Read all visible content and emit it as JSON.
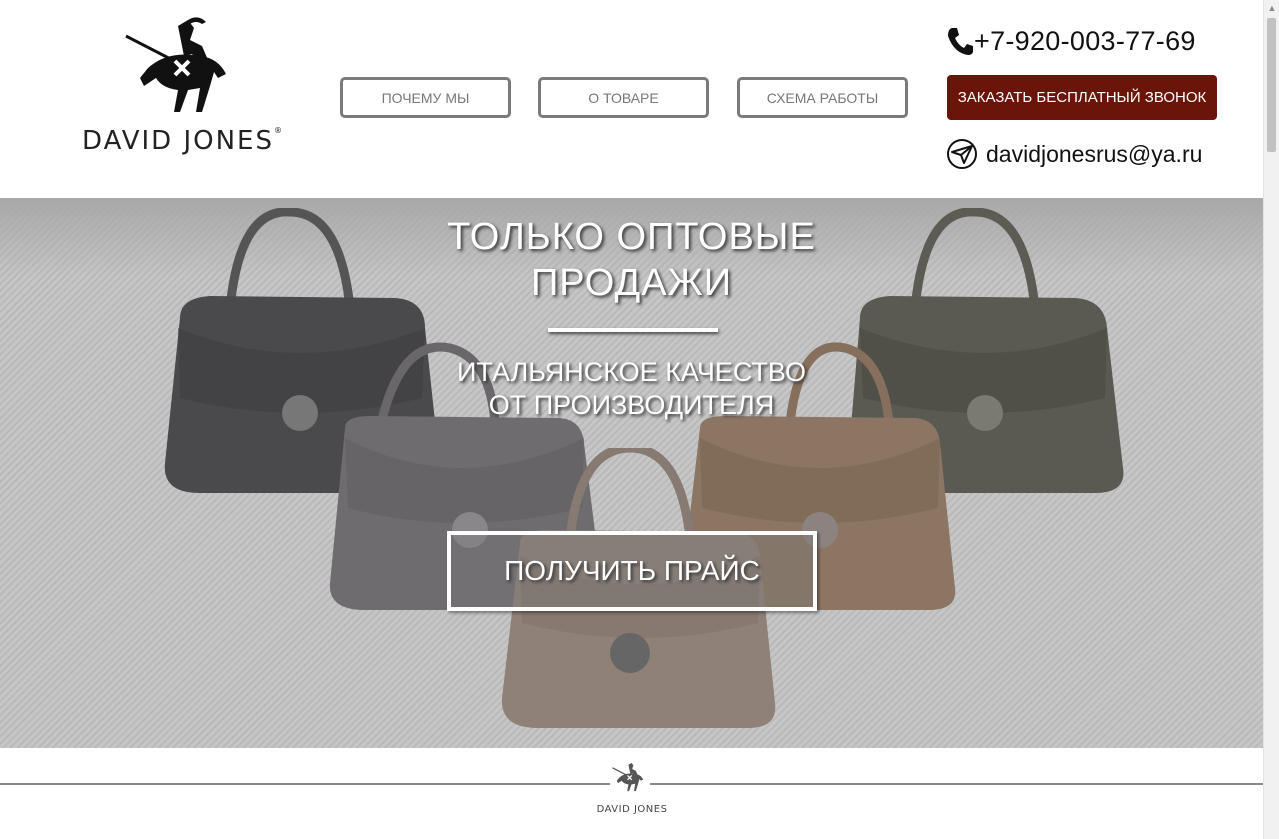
{
  "brand": {
    "name": "DAVID JONES",
    "registered_mark": "®"
  },
  "nav": {
    "items": [
      {
        "label": "ПОЧЕМУ МЫ"
      },
      {
        "label": "О ТОВАРЕ"
      },
      {
        "label": "СХЕМА РАБОТЫ"
      }
    ]
  },
  "contact": {
    "phone": "+7-920-003-77-69",
    "callback_label": "ЗАКАЗАТЬ БЕСПЛАТНЫЙ ЗВОНОК",
    "email": "davidjonesrus@ya.ru"
  },
  "hero": {
    "title_line1": "ТОЛЬКО ОПТОВЫЕ",
    "title_line2": "ПРОДАЖИ",
    "subtitle_line1": "ИТАЛЬЯНСКОЕ КАЧЕСТВО",
    "subtitle_line2": "ОТ ПРОИЗВОДИТЕЛЯ",
    "cta_label": "ПОЛУЧИТЬ ПРАЙС",
    "bag_colors": [
      "#4a4a4c",
      "#5a5a52",
      "#6f6c6f",
      "#8c7663",
      "#8f8178"
    ]
  },
  "footer": {
    "brand": "DAVID JONES"
  },
  "colors": {
    "accent": "#6b1409",
    "nav_border": "#7a7a7a"
  },
  "icons": {
    "phone": "phone-icon",
    "email": "email-icon",
    "logo": "knight-logo-icon"
  }
}
